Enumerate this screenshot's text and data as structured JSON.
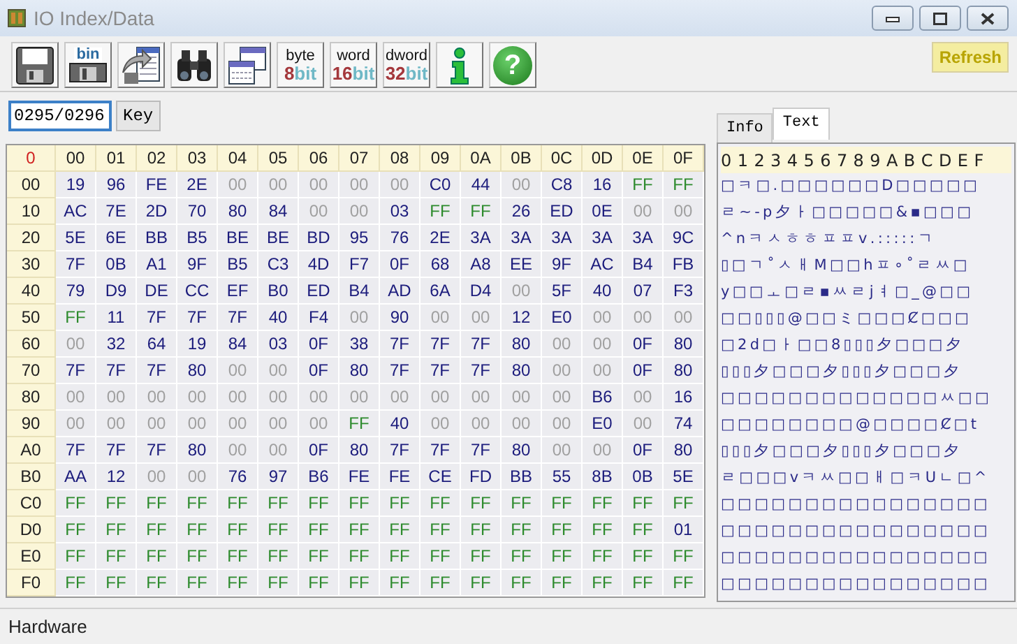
{
  "window": {
    "title": "IO Index/Data"
  },
  "toolbar": [
    {
      "kind": "save"
    },
    {
      "kind": "save_bin",
      "label": "bin"
    },
    {
      "kind": "export"
    },
    {
      "kind": "find"
    },
    {
      "kind": "windows"
    },
    {
      "kind": "width",
      "top": "byte",
      "num": "8",
      "unit": "bit"
    },
    {
      "kind": "width",
      "top": "word",
      "num": "16",
      "unit": "bit"
    },
    {
      "kind": "width",
      "top": "dword",
      "num": "32",
      "unit": "bit"
    },
    {
      "kind": "info"
    },
    {
      "kind": "help",
      "glyph": "?"
    }
  ],
  "refresh_button": "Refresh",
  "address": {
    "value": "0295/0296"
  },
  "key_button": "Key",
  "grid": {
    "corner": "0",
    "columns": [
      "00",
      "01",
      "02",
      "03",
      "04",
      "05",
      "06",
      "07",
      "08",
      "09",
      "0A",
      "0B",
      "0C",
      "0D",
      "0E",
      "0F"
    ],
    "rows": [
      {
        "label": "00",
        "cells": [
          {
            "text": "19",
            "color": "#1c1c7c"
          },
          {
            "text": "96",
            "color": "#1c1c7c"
          },
          {
            "text": "FE",
            "color": "#1c1c7c"
          },
          {
            "text": "2E",
            "color": "#1c1c7c"
          },
          {
            "text": "00",
            "color": "#a0a0a0"
          },
          {
            "text": "00",
            "color": "#a0a0a0"
          },
          {
            "text": "00",
            "color": "#a0a0a0"
          },
          {
            "text": "00",
            "color": "#a0a0a0"
          },
          {
            "text": "00",
            "color": "#a0a0a0"
          },
          {
            "text": "C0",
            "color": "#1c1c7c"
          },
          {
            "text": "44",
            "color": "#1c1c7c"
          },
          {
            "text": "00",
            "color": "#a0a0a0"
          },
          {
            "text": "C8",
            "color": "#1c1c7c"
          },
          {
            "text": "16",
            "color": "#1c1c7c"
          },
          {
            "text": "FF",
            "color": "#2e8b2e"
          },
          {
            "text": "FF",
            "color": "#2e8b2e"
          }
        ]
      },
      {
        "label": "10",
        "cells": [
          {
            "text": "AC",
            "color": "#1c1c7c"
          },
          {
            "text": "7E",
            "color": "#1c1c7c"
          },
          {
            "text": "2D",
            "color": "#1c1c7c"
          },
          {
            "text": "70",
            "color": "#1c1c7c"
          },
          {
            "text": "80",
            "color": "#1c1c7c"
          },
          {
            "text": "84",
            "color": "#1c1c7c"
          },
          {
            "text": "00",
            "color": "#a0a0a0"
          },
          {
            "text": "00",
            "color": "#a0a0a0"
          },
          {
            "text": "03",
            "color": "#1c1c7c"
          },
          {
            "text": "FF",
            "color": "#2e8b2e"
          },
          {
            "text": "FF",
            "color": "#2e8b2e"
          },
          {
            "text": "26",
            "color": "#1c1c7c"
          },
          {
            "text": "ED",
            "color": "#1c1c7c"
          },
          {
            "text": "0E",
            "color": "#1c1c7c"
          },
          {
            "text": "00",
            "color": "#a0a0a0"
          },
          {
            "text": "00",
            "color": "#a0a0a0"
          }
        ]
      },
      {
        "label": "20",
        "cells": [
          {
            "text": "5E",
            "color": "#1c1c7c"
          },
          {
            "text": "6E",
            "color": "#1c1c7c"
          },
          {
            "text": "BB",
            "color": "#1c1c7c"
          },
          {
            "text": "B5",
            "color": "#1c1c7c"
          },
          {
            "text": "BE",
            "color": "#1c1c7c"
          },
          {
            "text": "BE",
            "color": "#1c1c7c"
          },
          {
            "text": "BD",
            "color": "#1c1c7c"
          },
          {
            "text": "95",
            "color": "#1c1c7c"
          },
          {
            "text": "76",
            "color": "#1c1c7c"
          },
          {
            "text": "2E",
            "color": "#1c1c7c"
          },
          {
            "text": "3A",
            "color": "#1c1c7c"
          },
          {
            "text": "3A",
            "color": "#1c1c7c"
          },
          {
            "text": "3A",
            "color": "#1c1c7c"
          },
          {
            "text": "3A",
            "color": "#1c1c7c"
          },
          {
            "text": "3A",
            "color": "#1c1c7c"
          },
          {
            "text": "9C",
            "color": "#1c1c7c"
          }
        ]
      },
      {
        "label": "30",
        "cells": [
          {
            "text": "7F",
            "color": "#1c1c7c"
          },
          {
            "text": "0B",
            "color": "#1c1c7c"
          },
          {
            "text": "A1",
            "color": "#1c1c7c"
          },
          {
            "text": "9F",
            "color": "#1c1c7c"
          },
          {
            "text": "B5",
            "color": "#1c1c7c"
          },
          {
            "text": "C3",
            "color": "#1c1c7c"
          },
          {
            "text": "4D",
            "color": "#1c1c7c"
          },
          {
            "text": "F7",
            "color": "#1c1c7c"
          },
          {
            "text": "0F",
            "color": "#1c1c7c"
          },
          {
            "text": "68",
            "color": "#1c1c7c"
          },
          {
            "text": "A8",
            "color": "#1c1c7c"
          },
          {
            "text": "EE",
            "color": "#1c1c7c"
          },
          {
            "text": "9F",
            "color": "#1c1c7c"
          },
          {
            "text": "AC",
            "color": "#1c1c7c"
          },
          {
            "text": "B4",
            "color": "#1c1c7c"
          },
          {
            "text": "FB",
            "color": "#1c1c7c"
          }
        ]
      },
      {
        "label": "40",
        "cells": [
          {
            "text": "79",
            "color": "#1c1c7c"
          },
          {
            "text": "D9",
            "color": "#1c1c7c"
          },
          {
            "text": "DE",
            "color": "#1c1c7c"
          },
          {
            "text": "CC",
            "color": "#1c1c7c"
          },
          {
            "text": "EF",
            "color": "#1c1c7c"
          },
          {
            "text": "B0",
            "color": "#1c1c7c"
          },
          {
            "text": "ED",
            "color": "#1c1c7c"
          },
          {
            "text": "B4",
            "color": "#1c1c7c"
          },
          {
            "text": "AD",
            "color": "#1c1c7c"
          },
          {
            "text": "6A",
            "color": "#1c1c7c"
          },
          {
            "text": "D4",
            "color": "#1c1c7c"
          },
          {
            "text": "00",
            "color": "#a0a0a0"
          },
          {
            "text": "5F",
            "color": "#1c1c7c"
          },
          {
            "text": "40",
            "color": "#1c1c7c"
          },
          {
            "text": "07",
            "color": "#1c1c7c"
          },
          {
            "text": "F3",
            "color": "#1c1c7c"
          }
        ]
      },
      {
        "label": "50",
        "cells": [
          {
            "text": "FF",
            "color": "#2e8b2e"
          },
          {
            "text": "11",
            "color": "#1c1c7c"
          },
          {
            "text": "7F",
            "color": "#1c1c7c"
          },
          {
            "text": "7F",
            "color": "#1c1c7c"
          },
          {
            "text": "7F",
            "color": "#1c1c7c"
          },
          {
            "text": "40",
            "color": "#1c1c7c"
          },
          {
            "text": "F4",
            "color": "#1c1c7c"
          },
          {
            "text": "00",
            "color": "#a0a0a0"
          },
          {
            "text": "90",
            "color": "#1c1c7c"
          },
          {
            "text": "00",
            "color": "#a0a0a0"
          },
          {
            "text": "00",
            "color": "#a0a0a0"
          },
          {
            "text": "12",
            "color": "#1c1c7c"
          },
          {
            "text": "E0",
            "color": "#1c1c7c"
          },
          {
            "text": "00",
            "color": "#a0a0a0"
          },
          {
            "text": "00",
            "color": "#a0a0a0"
          },
          {
            "text": "00",
            "color": "#a0a0a0"
          }
        ]
      },
      {
        "label": "60",
        "cells": [
          {
            "text": "00",
            "color": "#a0a0a0"
          },
          {
            "text": "32",
            "color": "#1c1c7c"
          },
          {
            "text": "64",
            "color": "#1c1c7c"
          },
          {
            "text": "19",
            "color": "#1c1c7c"
          },
          {
            "text": "84",
            "color": "#1c1c7c"
          },
          {
            "text": "03",
            "color": "#1c1c7c"
          },
          {
            "text": "0F",
            "color": "#1c1c7c"
          },
          {
            "text": "38",
            "color": "#1c1c7c"
          },
          {
            "text": "7F",
            "color": "#1c1c7c"
          },
          {
            "text": "7F",
            "color": "#1c1c7c"
          },
          {
            "text": "7F",
            "color": "#1c1c7c"
          },
          {
            "text": "80",
            "color": "#1c1c7c"
          },
          {
            "text": "00",
            "color": "#a0a0a0"
          },
          {
            "text": "00",
            "color": "#a0a0a0"
          },
          {
            "text": "0F",
            "color": "#1c1c7c"
          },
          {
            "text": "80",
            "color": "#1c1c7c"
          }
        ]
      },
      {
        "label": "70",
        "cells": [
          {
            "text": "7F",
            "color": "#1c1c7c"
          },
          {
            "text": "7F",
            "color": "#1c1c7c"
          },
          {
            "text": "7F",
            "color": "#1c1c7c"
          },
          {
            "text": "80",
            "color": "#1c1c7c"
          },
          {
            "text": "00",
            "color": "#a0a0a0"
          },
          {
            "text": "00",
            "color": "#a0a0a0"
          },
          {
            "text": "0F",
            "color": "#1c1c7c"
          },
          {
            "text": "80",
            "color": "#1c1c7c"
          },
          {
            "text": "7F",
            "color": "#1c1c7c"
          },
          {
            "text": "7F",
            "color": "#1c1c7c"
          },
          {
            "text": "7F",
            "color": "#1c1c7c"
          },
          {
            "text": "80",
            "color": "#1c1c7c"
          },
          {
            "text": "00",
            "color": "#a0a0a0"
          },
          {
            "text": "00",
            "color": "#a0a0a0"
          },
          {
            "text": "0F",
            "color": "#1c1c7c"
          },
          {
            "text": "80",
            "color": "#1c1c7c"
          }
        ]
      },
      {
        "label": "80",
        "cells": [
          {
            "text": "00",
            "color": "#a0a0a0"
          },
          {
            "text": "00",
            "color": "#a0a0a0"
          },
          {
            "text": "00",
            "color": "#a0a0a0"
          },
          {
            "text": "00",
            "color": "#a0a0a0"
          },
          {
            "text": "00",
            "color": "#a0a0a0"
          },
          {
            "text": "00",
            "color": "#a0a0a0"
          },
          {
            "text": "00",
            "color": "#a0a0a0"
          },
          {
            "text": "00",
            "color": "#a0a0a0"
          },
          {
            "text": "00",
            "color": "#a0a0a0"
          },
          {
            "text": "00",
            "color": "#a0a0a0"
          },
          {
            "text": "00",
            "color": "#a0a0a0"
          },
          {
            "text": "00",
            "color": "#a0a0a0"
          },
          {
            "text": "00",
            "color": "#a0a0a0"
          },
          {
            "text": "B6",
            "color": "#1c1c7c"
          },
          {
            "text": "00",
            "color": "#a0a0a0"
          },
          {
            "text": "16",
            "color": "#1c1c7c"
          }
        ]
      },
      {
        "label": "90",
        "cells": [
          {
            "text": "00",
            "color": "#a0a0a0"
          },
          {
            "text": "00",
            "color": "#a0a0a0"
          },
          {
            "text": "00",
            "color": "#a0a0a0"
          },
          {
            "text": "00",
            "color": "#a0a0a0"
          },
          {
            "text": "00",
            "color": "#a0a0a0"
          },
          {
            "text": "00",
            "color": "#a0a0a0"
          },
          {
            "text": "00",
            "color": "#a0a0a0"
          },
          {
            "text": "FF",
            "color": "#2e8b2e"
          },
          {
            "text": "40",
            "color": "#1c1c7c"
          },
          {
            "text": "00",
            "color": "#a0a0a0"
          },
          {
            "text": "00",
            "color": "#a0a0a0"
          },
          {
            "text": "00",
            "color": "#a0a0a0"
          },
          {
            "text": "00",
            "color": "#a0a0a0"
          },
          {
            "text": "E0",
            "color": "#1c1c7c"
          },
          {
            "text": "00",
            "color": "#a0a0a0"
          },
          {
            "text": "74",
            "color": "#1c1c7c"
          }
        ]
      },
      {
        "label": "A0",
        "cells": [
          {
            "text": "7F",
            "color": "#1c1c7c"
          },
          {
            "text": "7F",
            "color": "#1c1c7c"
          },
          {
            "text": "7F",
            "color": "#1c1c7c"
          },
          {
            "text": "80",
            "color": "#1c1c7c"
          },
          {
            "text": "00",
            "color": "#a0a0a0"
          },
          {
            "text": "00",
            "color": "#a0a0a0"
          },
          {
            "text": "0F",
            "color": "#1c1c7c"
          },
          {
            "text": "80",
            "color": "#1c1c7c"
          },
          {
            "text": "7F",
            "color": "#1c1c7c"
          },
          {
            "text": "7F",
            "color": "#1c1c7c"
          },
          {
            "text": "7F",
            "color": "#1c1c7c"
          },
          {
            "text": "80",
            "color": "#1c1c7c"
          },
          {
            "text": "00",
            "color": "#a0a0a0"
          },
          {
            "text": "00",
            "color": "#a0a0a0"
          },
          {
            "text": "0F",
            "color": "#1c1c7c"
          },
          {
            "text": "80",
            "color": "#1c1c7c"
          }
        ]
      },
      {
        "label": "B0",
        "cells": [
          {
            "text": "AA",
            "color": "#1c1c7c"
          },
          {
            "text": "12",
            "color": "#1c1c7c"
          },
          {
            "text": "00",
            "color": "#a0a0a0"
          },
          {
            "text": "00",
            "color": "#a0a0a0"
          },
          {
            "text": "76",
            "color": "#1c1c7c"
          },
          {
            "text": "97",
            "color": "#1c1c7c"
          },
          {
            "text": "B6",
            "color": "#1c1c7c"
          },
          {
            "text": "FE",
            "color": "#1c1c7c"
          },
          {
            "text": "FE",
            "color": "#1c1c7c"
          },
          {
            "text": "CE",
            "color": "#1c1c7c"
          },
          {
            "text": "FD",
            "color": "#1c1c7c"
          },
          {
            "text": "BB",
            "color": "#1c1c7c"
          },
          {
            "text": "55",
            "color": "#1c1c7c"
          },
          {
            "text": "8B",
            "color": "#1c1c7c"
          },
          {
            "text": "0B",
            "color": "#1c1c7c"
          },
          {
            "text": "5E",
            "color": "#1c1c7c"
          }
        ]
      },
      {
        "label": "C0",
        "cells": [
          {
            "text": "FF",
            "color": "#2e8b2e"
          },
          {
            "text": "FF",
            "color": "#2e8b2e"
          },
          {
            "text": "FF",
            "color": "#2e8b2e"
          },
          {
            "text": "FF",
            "color": "#2e8b2e"
          },
          {
            "text": "FF",
            "color": "#2e8b2e"
          },
          {
            "text": "FF",
            "color": "#2e8b2e"
          },
          {
            "text": "FF",
            "color": "#2e8b2e"
          },
          {
            "text": "FF",
            "color": "#2e8b2e"
          },
          {
            "text": "FF",
            "color": "#2e8b2e"
          },
          {
            "text": "FF",
            "color": "#2e8b2e"
          },
          {
            "text": "FF",
            "color": "#2e8b2e"
          },
          {
            "text": "FF",
            "color": "#2e8b2e"
          },
          {
            "text": "FF",
            "color": "#2e8b2e"
          },
          {
            "text": "FF",
            "color": "#2e8b2e"
          },
          {
            "text": "FF",
            "color": "#2e8b2e"
          },
          {
            "text": "FF",
            "color": "#2e8b2e"
          }
        ]
      },
      {
        "label": "D0",
        "cells": [
          {
            "text": "FF",
            "color": "#2e8b2e"
          },
          {
            "text": "FF",
            "color": "#2e8b2e"
          },
          {
            "text": "FF",
            "color": "#2e8b2e"
          },
          {
            "text": "FF",
            "color": "#2e8b2e"
          },
          {
            "text": "FF",
            "color": "#2e8b2e"
          },
          {
            "text": "FF",
            "color": "#2e8b2e"
          },
          {
            "text": "FF",
            "color": "#2e8b2e"
          },
          {
            "text": "FF",
            "color": "#2e8b2e"
          },
          {
            "text": "FF",
            "color": "#2e8b2e"
          },
          {
            "text": "FF",
            "color": "#2e8b2e"
          },
          {
            "text": "FF",
            "color": "#2e8b2e"
          },
          {
            "text": "FF",
            "color": "#2e8b2e"
          },
          {
            "text": "FF",
            "color": "#2e8b2e"
          },
          {
            "text": "FF",
            "color": "#2e8b2e"
          },
          {
            "text": "FF",
            "color": "#2e8b2e"
          },
          {
            "text": "01",
            "color": "#1c1c7c"
          }
        ]
      },
      {
        "label": "E0",
        "cells": [
          {
            "text": "FF",
            "color": "#2e8b2e"
          },
          {
            "text": "FF",
            "color": "#2e8b2e"
          },
          {
            "text": "FF",
            "color": "#2e8b2e"
          },
          {
            "text": "FF",
            "color": "#2e8b2e"
          },
          {
            "text": "FF",
            "color": "#2e8b2e"
          },
          {
            "text": "FF",
            "color": "#2e8b2e"
          },
          {
            "text": "FF",
            "color": "#2e8b2e"
          },
          {
            "text": "FF",
            "color": "#2e8b2e"
          },
          {
            "text": "FF",
            "color": "#2e8b2e"
          },
          {
            "text": "FF",
            "color": "#2e8b2e"
          },
          {
            "text": "FF",
            "color": "#2e8b2e"
          },
          {
            "text": "FF",
            "color": "#2e8b2e"
          },
          {
            "text": "FF",
            "color": "#2e8b2e"
          },
          {
            "text": "FF",
            "color": "#2e8b2e"
          },
          {
            "text": "FF",
            "color": "#2e8b2e"
          },
          {
            "text": "FF",
            "color": "#2e8b2e"
          }
        ]
      },
      {
        "label": "F0",
        "cells": [
          {
            "text": "FF",
            "color": "#2e8b2e"
          },
          {
            "text": "FF",
            "color": "#2e8b2e"
          },
          {
            "text": "FF",
            "color": "#2e8b2e"
          },
          {
            "text": "FF",
            "color": "#2e8b2e"
          },
          {
            "text": "FF",
            "color": "#2e8b2e"
          },
          {
            "text": "FF",
            "color": "#2e8b2e"
          },
          {
            "text": "FF",
            "color": "#2e8b2e"
          },
          {
            "text": "FF",
            "color": "#2e8b2e"
          },
          {
            "text": "FF",
            "color": "#2e8b2e"
          },
          {
            "text": "FF",
            "color": "#2e8b2e"
          },
          {
            "text": "FF",
            "color": "#2e8b2e"
          },
          {
            "text": "FF",
            "color": "#2e8b2e"
          },
          {
            "text": "FF",
            "color": "#2e8b2e"
          },
          {
            "text": "FF",
            "color": "#2e8b2e"
          },
          {
            "text": "FF",
            "color": "#2e8b2e"
          },
          {
            "text": "FF",
            "color": "#2e8b2e"
          }
        ]
      }
    ]
  },
  "side_tabs": [
    {
      "label": "Info",
      "selected": false
    },
    {
      "label": "Text",
      "selected": true
    }
  ],
  "text_view": {
    "header": "0 1 2 3 4 5 6 7 8 9 A B C D E F",
    "rows": [
      "□ ㅋ □ . □ □ □ □ □ □ D □ □ □ □ □",
      "ㄹ ~ - p 夕 ㅏ □ □ □ □ □ & ▪ □ □ □",
      "^ n ㅋ ㅅ ㅎ ㅎ ㅍ ㅍ v . : : : : : ㄱ",
      "▯ □ ㄱ ˚ ㅅ ㅐ M □ □ h ㅍ ∘ ˚ ㄹ ㅆ □",
      "y □ □ ㅗ □ ㄹ ▪ ㅆ ㄹ j ㅕ □ _ @ □ □",
      "□ □ ▯ ▯ ▯ @ □ □ ミ □ □ □ Ȼ □ □ □",
      "□ 2 d □ ㅏ □ □ 8 ▯ ▯ ▯ 夕 □ □ □ 夕",
      "▯ ▯ ▯ 夕 □ □ □ 夕 ▯ ▯ ▯ 夕 □ □ □ 夕",
      "□ □ □ □ □ □ □ □ □ □ □ □ □ ㅆ □ □",
      "□ □ □ □ □ □ □ □ @ □ □ □ □ Ȼ □ t",
      "▯ ▯ ▯ 夕 □ □ □ 夕 ▯ ▯ ▯ 夕 □ □ □ 夕",
      "ㄹ □ □ □ v ㅋ ㅆ □ □ ㅐ □ ㅋ U ㄴ □ ^",
      "□ □ □ □ □ □ □ □ □ □ □ □ □ □ □ □",
      "□ □ □ □ □ □ □ □ □ □ □ □ □ □ □ □",
      "□ □ □ □ □ □ □ □ □ □ □ □ □ □ □ □",
      "□ □ □ □ □ □ □ □ □ □ □ □ □ □ □ □"
    ]
  },
  "status_bar": {
    "text": "Hardware"
  }
}
